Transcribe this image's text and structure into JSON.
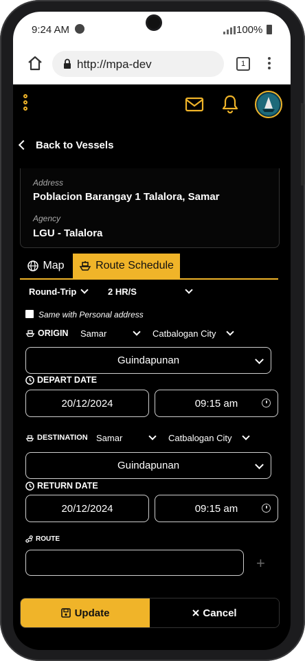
{
  "status_bar": {
    "time": "9:24 AM",
    "battery": "100%"
  },
  "browser": {
    "url": "http://mpa-dev",
    "tab_count": "1"
  },
  "nav": {
    "back_label": "Back to Vessels"
  },
  "card": {
    "address_label": "Address",
    "address_value": "Poblacion Barangay 1 Talalora, Samar",
    "agency_label": "Agency",
    "agency_value": "LGU - Talalora"
  },
  "tabs": {
    "map": "Map",
    "route_schedule": "Route Schedule"
  },
  "trip": {
    "type": "Round-Trip",
    "duration": "2 HR/S"
  },
  "same_address_label": "Same with Personal address",
  "origin": {
    "title": "ORIGIN",
    "province": "Samar",
    "city": "Catbalogan City",
    "barangay": "Guindapunan"
  },
  "depart": {
    "title": "DEPART DATE",
    "date": "20/12/2024",
    "time": "09:15 am"
  },
  "destination": {
    "title": "DESTINATION",
    "province": "Samar",
    "city": "Catbalogan City",
    "barangay": "Guindapunan"
  },
  "return": {
    "title": "RETURN DATE",
    "date": "20/12/2024",
    "time": "09:15 am"
  },
  "route": {
    "title": "ROUTE",
    "value": "",
    "add_label": "+"
  },
  "actions": {
    "update": "Update",
    "cancel": "Cancel"
  },
  "colors": {
    "accent": "#f0b429",
    "background": "#000000"
  }
}
